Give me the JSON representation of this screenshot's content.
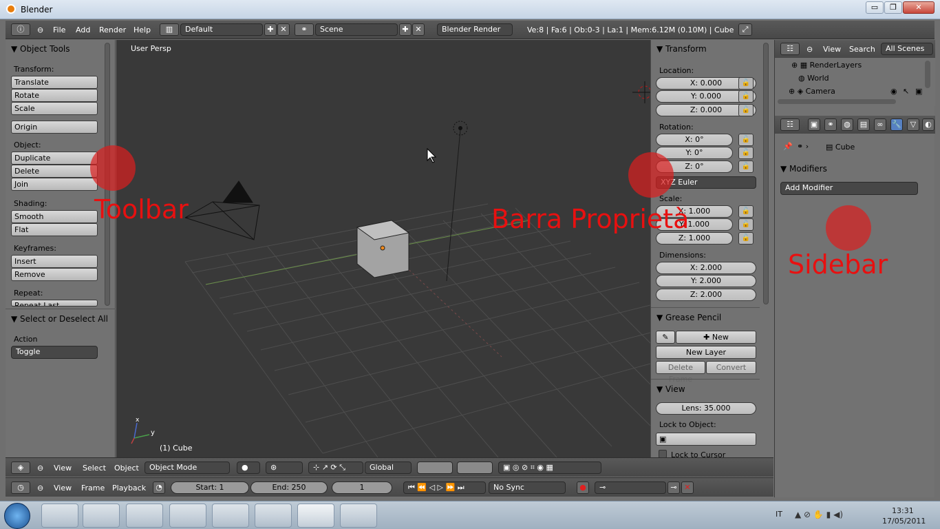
{
  "window": {
    "title": "Blender",
    "minimize": "▭",
    "maximize": "❐",
    "close": "✕"
  },
  "topbar": {
    "menus": [
      "File",
      "Add",
      "Render",
      "Help"
    ],
    "screen_layout": "Default",
    "scene": "Scene",
    "render_engine": "Blender Render",
    "stats": "Ve:8 | Fa:6 | Ob:0-3 | La:1 | Mem:6.12M (0.10M) | Cube"
  },
  "toolshelf": {
    "panel_title": "Object Tools",
    "transform_label": "Transform:",
    "translate": "Translate",
    "rotate": "Rotate",
    "scale": "Scale",
    "origin": "Origin",
    "object_label": "Object:",
    "duplicate": "Duplicate",
    "delete": "Delete",
    "join": "Join",
    "shading_label": "Shading:",
    "smooth": "Smooth",
    "flat": "Flat",
    "keyframes_label": "Keyframes:",
    "insert": "Insert",
    "remove": "Remove",
    "repeat_label": "Repeat:",
    "repeat_last": "Repeat Last",
    "operator_title": "Select or Deselect All",
    "action_label": "Action",
    "action_value": "Toggle"
  },
  "viewport": {
    "view_name": "User Persp",
    "object_name": "(1) Cube",
    "axis_y": "y",
    "axis_x": "x"
  },
  "npanel": {
    "transform_title": "Transform",
    "location_label": "Location:",
    "loc_x": "X: 0.000",
    "loc_y": "Y: 0.000",
    "loc_z": "Z: 0.000",
    "rotation_label": "Rotation:",
    "rot_x": "X: 0°",
    "rot_y": "Y: 0°",
    "rot_z": "Z: 0°",
    "rotation_mode": "XYZ Euler",
    "scale_label": "Scale:",
    "scale_x": "X: 1.000",
    "scale_y": "Y: 1.000",
    "scale_z": "Z: 1.000",
    "dimensions_label": "Dimensions:",
    "dim_x": "X: 2.000",
    "dim_y": "Y: 2.000",
    "dim_z": "Z: 2.000",
    "grease_title": "Grease Pencil",
    "new": "New",
    "new_layer": "New Layer",
    "delete_frame": "Delete Frame",
    "convert": "Convert",
    "view_title": "View",
    "lens": "Lens: 35.000",
    "lock_object_label": "Lock to Object:",
    "lock_cursor": "Lock to Cursor"
  },
  "outliner": {
    "view": "View",
    "search": "Search",
    "scope": "All Scenes",
    "items": [
      "RenderLayers",
      "World",
      "Camera"
    ]
  },
  "properties": {
    "object_name": "Cube",
    "modifiers_title": "Modifiers",
    "add_modifier": "Add Modifier"
  },
  "header3d": {
    "menus": [
      "View",
      "Select",
      "Object"
    ],
    "mode": "Object Mode",
    "orientation": "Global"
  },
  "timeline": {
    "menus": [
      "View",
      "Frame",
      "Playback"
    ],
    "start": "Start: 1",
    "end": "End: 250",
    "current": "1",
    "sync": "No Sync"
  },
  "annotations": {
    "toolbar": "Toolbar",
    "properties_bar": "Barra Proprietà",
    "sidebar": "Sidebar"
  },
  "taskbar": {
    "lang": "IT",
    "time": "13:31",
    "date": "17/05/2011"
  }
}
